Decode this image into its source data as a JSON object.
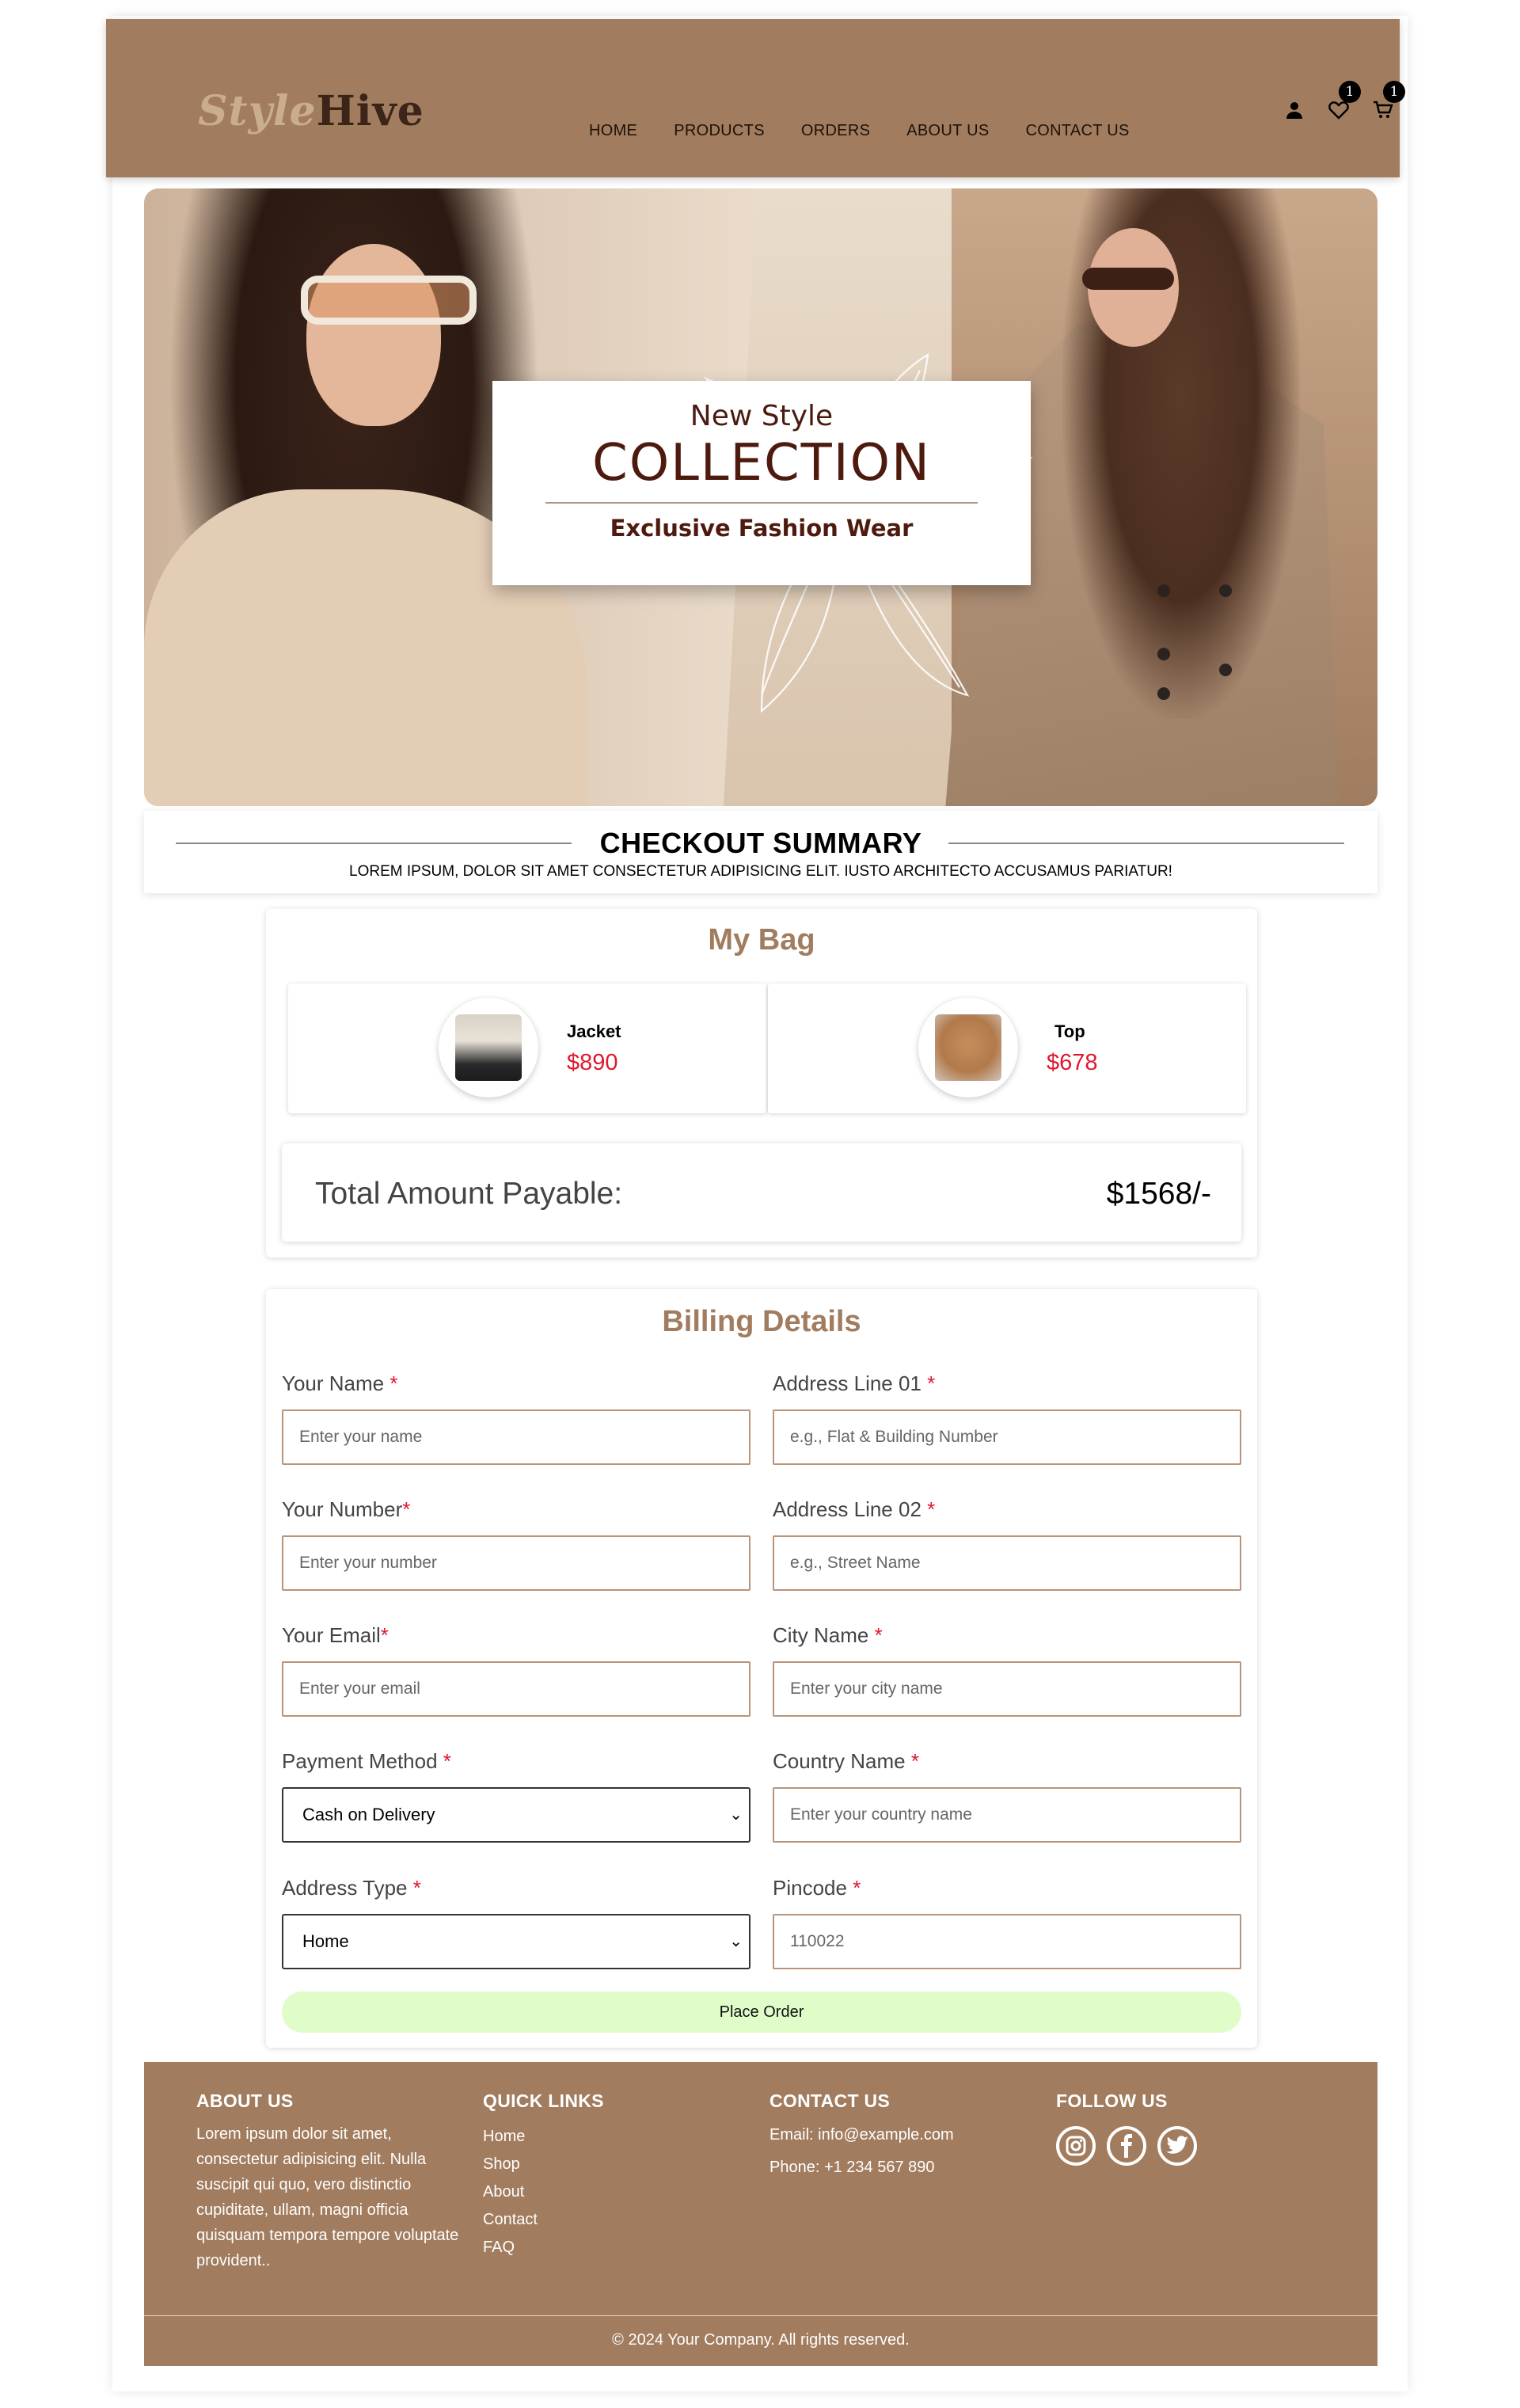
{
  "brand": {
    "logo_part1": "Style",
    "logo_part2": "Hive"
  },
  "nav": {
    "items": [
      "HOME",
      "PRODUCTS",
      "ORDERS",
      "ABOUT US",
      "CONTACT US"
    ]
  },
  "header_icons": {
    "user": "user-icon",
    "wishlist": {
      "icon": "heart-icon",
      "count": "1"
    },
    "cart": {
      "icon": "cart-icon",
      "count": "1"
    }
  },
  "hero": {
    "small": "New Style",
    "big": "COLLECTION",
    "sub": "Exclusive Fashion Wear"
  },
  "checkout": {
    "title": "CHECKOUT SUMMARY",
    "subtitle": "LOREM IPSUM, DOLOR SIT AMET CONSECTETUR ADIPISICING ELIT. IUSTO ARCHITECTO ACCUSAMUS PARIATUR!"
  },
  "bag": {
    "title": "My Bag",
    "items": [
      {
        "name": "Jacket",
        "price": "$890"
      },
      {
        "name": "Top",
        "price": "$678"
      }
    ],
    "total_label": "Total Amount Payable:",
    "total_value": "$1568/-"
  },
  "billing": {
    "title": "Billing Details",
    "left": [
      {
        "label": "Your Name",
        "req": " *",
        "placeholder": "Enter your name"
      },
      {
        "label": "Your Number",
        "req": "*",
        "placeholder": "Enter your number"
      },
      {
        "label": "Your Email",
        "req": "*",
        "placeholder": "Enter your email"
      }
    ],
    "right": [
      {
        "label": "Address Line 01",
        "req": " *",
        "placeholder": "e.g., Flat & Building Number"
      },
      {
        "label": "Address Line 02",
        "req": " *",
        "placeholder": "e.g., Street Name"
      },
      {
        "label": "City Name",
        "req": " *",
        "placeholder": "Enter your city name"
      },
      {
        "label": "Country Name",
        "req": " *",
        "placeholder": "Enter your country name"
      },
      {
        "label": "Pincode",
        "req": " *",
        "placeholder": "110022"
      }
    ],
    "payment": {
      "label": "Payment Method",
      "req": " *",
      "value": "Cash on Delivery"
    },
    "address_type": {
      "label": "Address Type",
      "req": " *",
      "value": "Home"
    },
    "submit": "Place Order"
  },
  "footer": {
    "about": {
      "title": "ABOUT US",
      "text": "Lorem ipsum dolor sit amet, consectetur adipisicing elit. Nulla suscipit qui quo, vero distinctio cupiditate, ullam, magni officia quisquam tempora tempore voluptate provident.."
    },
    "links": {
      "title": "QUICK LINKS",
      "items": [
        "Home",
        "Shop",
        "About",
        "Contact",
        "FAQ"
      ]
    },
    "contact": {
      "title": "CONTACT US",
      "email": "Email: info@example.com",
      "phone": "Phone: +1 234 567 890"
    },
    "follow": {
      "title": "FOLLOW US",
      "icons": [
        "instagram-icon",
        "facebook-icon",
        "twitter-icon"
      ]
    },
    "copyright": "© 2024 Your Company. All rights reserved."
  },
  "colors": {
    "brand": "#a17c5e",
    "price": "#e0182d",
    "button": "#e0fcc9"
  }
}
